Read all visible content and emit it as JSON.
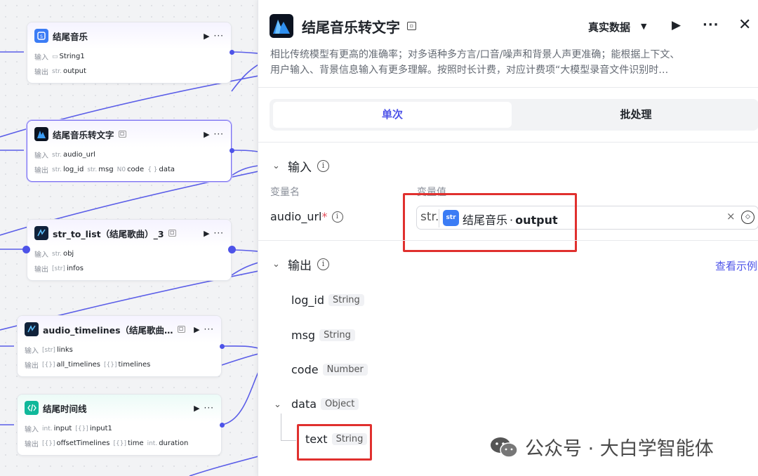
{
  "canvas": {
    "nodes": [
      {
        "id": "n1",
        "title": "结尾音乐",
        "has_badge": false,
        "inputs": [
          {
            "type_icon": "folder",
            "name": "String1"
          }
        ],
        "outputs": [
          {
            "type": "str.",
            "name": "output"
          }
        ]
      },
      {
        "id": "n2",
        "title": "结尾音乐转文字",
        "has_badge": true,
        "inputs": [
          {
            "type": "str.",
            "name": "audio_url"
          }
        ],
        "outputs": [
          {
            "type": "str.",
            "name": "log_id"
          },
          {
            "type": "str.",
            "name": "msg"
          },
          {
            "type": "N0",
            "name": "code"
          },
          {
            "type": "{ }",
            "name": "data"
          }
        ]
      },
      {
        "id": "n3",
        "title": "str_to_list（结尾歌曲）_3",
        "has_badge": true,
        "inputs": [
          {
            "type": "str.",
            "name": "obj"
          }
        ],
        "outputs": [
          {
            "type": "[str]",
            "name": "infos"
          }
        ]
      },
      {
        "id": "n4",
        "title": "audio_timelines（结尾歌曲…",
        "has_badge": true,
        "inputs": [
          {
            "type": "[str]",
            "name": "links"
          }
        ],
        "outputs": [
          {
            "type": "[{}]",
            "name": "all_timelines"
          },
          {
            "type": "[{}]",
            "name": "timelines"
          }
        ]
      },
      {
        "id": "n5",
        "title": "结尾时间线",
        "has_badge": false,
        "inputs": [
          {
            "type": "int.",
            "name": "input"
          },
          {
            "type": "[{}]",
            "name": "input1"
          }
        ],
        "outputs": [
          {
            "type": "[{}]",
            "name": "offsetTimelines"
          },
          {
            "type": "[{}]",
            "name": "time"
          },
          {
            "type": "int.",
            "name": "duration"
          }
        ]
      }
    ],
    "labels": {
      "input": "输入",
      "output": "输出"
    }
  },
  "panel": {
    "title": "结尾音乐转文字",
    "mode": "真实数据",
    "description_lines": [
      "相比传统模型有更高的准确率；对多语种多方言/口音/噪声和背景人声更准确；能根据上下文、",
      "用户输入、背景信息输入有更多理解。按照时长计费，对应计费项“大模型录音文件识别时…"
    ],
    "tabs": [
      {
        "label": "单次",
        "active": true
      },
      {
        "label": "批处理",
        "active": false
      }
    ],
    "input_section": {
      "title": "输入",
      "col_name": "变量名",
      "col_value": "变量值",
      "field": {
        "name": "audio_url",
        "required_mark": "*",
        "type": "str.",
        "source_node": "结尾音乐",
        "dot": "·",
        "source_var": "output",
        "source_icon_text": "str"
      }
    },
    "output_section": {
      "title": "输出",
      "link": "查看示例",
      "outputs": [
        {
          "name": "log_id",
          "type": "String"
        },
        {
          "name": "msg",
          "type": "String"
        },
        {
          "name": "code",
          "type": "Number"
        },
        {
          "name": "data",
          "type": "Object"
        },
        {
          "name": "text",
          "type": "String"
        }
      ]
    }
  },
  "watermark": "公众号 · 大白学智能体",
  "colors": {
    "accent": "#4d53e8",
    "highlight": "#e0302e",
    "wire": "#5b5ee8"
  }
}
